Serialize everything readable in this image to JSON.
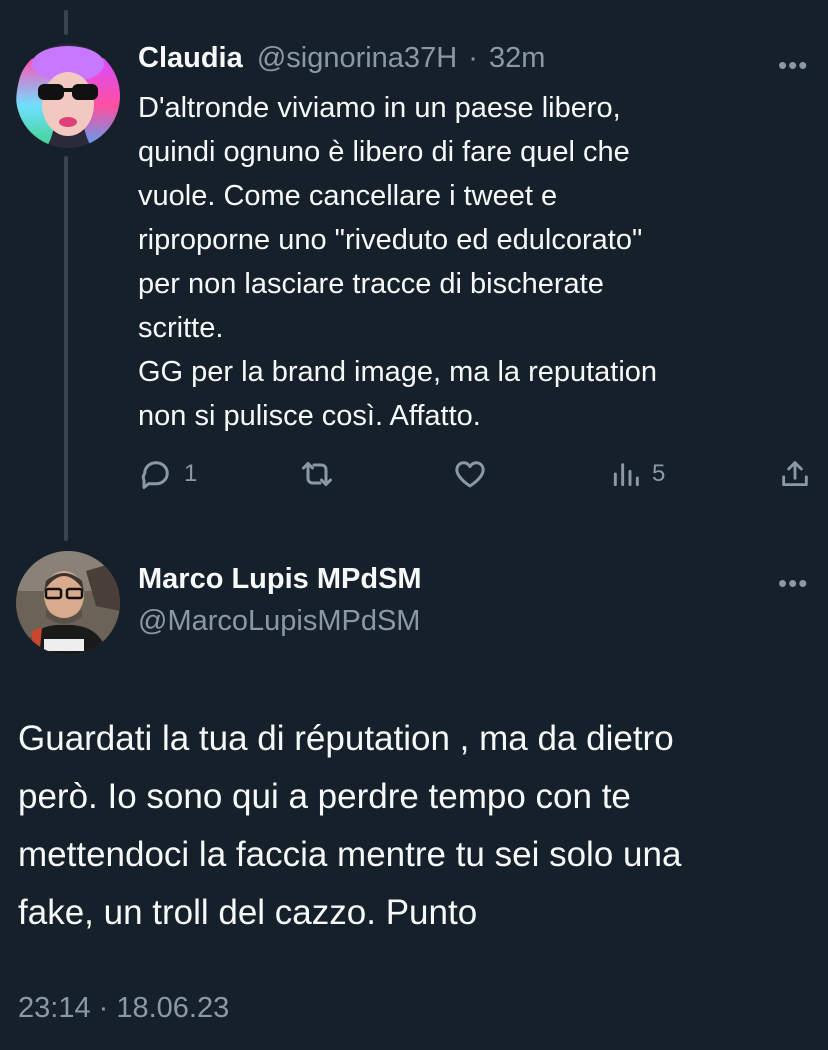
{
  "reply_tweet": {
    "display_name": "Claudia",
    "handle": "@signorina37H",
    "separator": "·",
    "time_ago": "32m",
    "more_label": "•••",
    "text": "D'altronde viviamo in un paese libero,\nquindi ognuno è libero di fare quel che\nvuole. Come cancellare i tweet e\nriproporne uno \"riveduto ed edulcorato\"\nper non lasciare tracce di bischerate\nscritte.\nGG per la brand image, ma la reputation\nnon si pulisce così. Affatto.",
    "actions": {
      "reply_count": "1",
      "retweet_count": "",
      "like_count": "",
      "views_count": "5"
    },
    "icons": [
      "reply-icon",
      "retweet-icon",
      "like-icon",
      "views-icon",
      "share-icon"
    ]
  },
  "main_tweet": {
    "display_name": "Marco Lupis MPdSM",
    "handle": "@MarcoLupisMPdSM",
    "more_label": "•••",
    "text": "Guardati la  tua di réputation , ma  da dietro\nperò. Io sono qui a perdre tempo con te\nmettendoci la faccia mentre tu sei solo una\nfake, un troll del cazzo. Punto",
    "timestamp": "23:14 · 18.06.23"
  },
  "colors": {
    "background": "#15202b",
    "text": "#f7f9f9",
    "muted": "#8b98a5",
    "thread_line": "#38444d"
  }
}
